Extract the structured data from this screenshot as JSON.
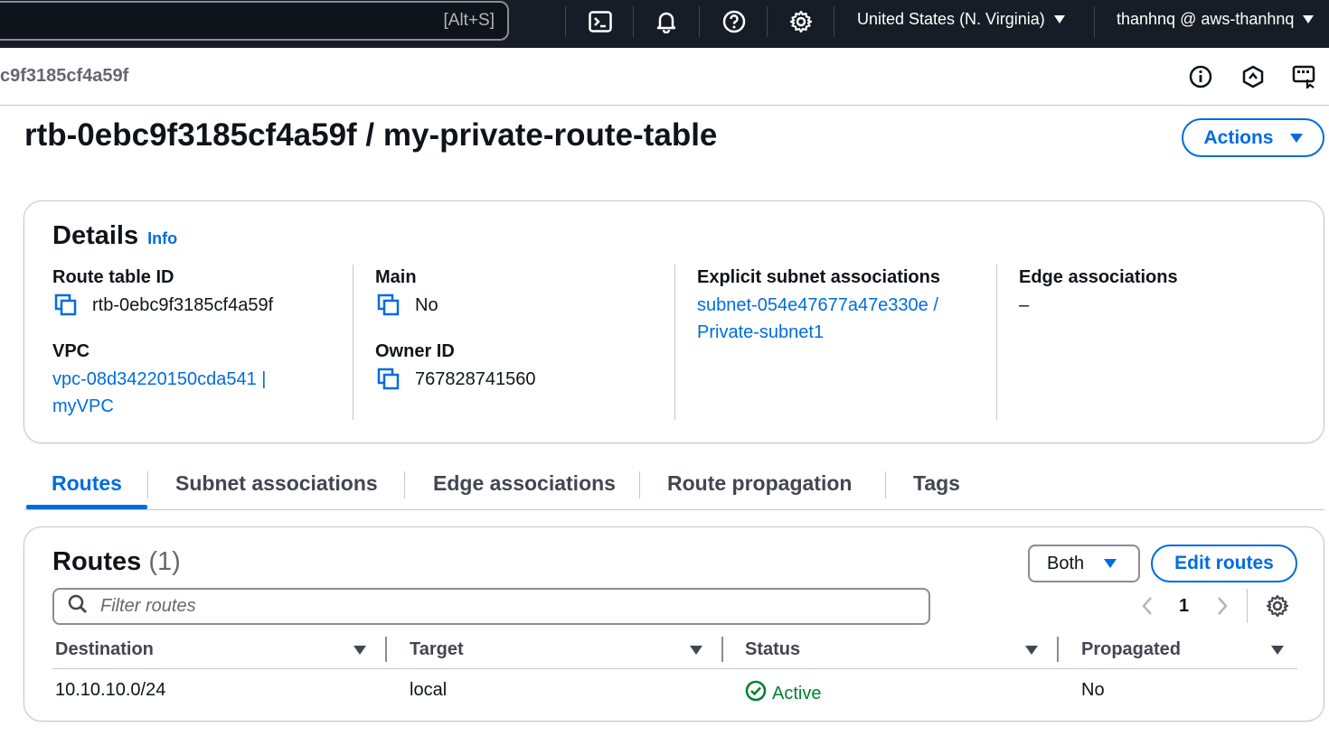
{
  "topnav": {
    "search_shortcut": "[Alt+S]",
    "icons": [
      "cloudshell-icon",
      "bell-icon",
      "help-icon",
      "settings-icon"
    ],
    "region": "United States (N. Virginia)",
    "account": "thanhnq @ aws-thanhnq"
  },
  "breadcrumb": {
    "current": "c9f3185cf4a59f"
  },
  "toolbar_icons": [
    "info-icon",
    "notifications-hex-icon",
    "feedback-icon"
  ],
  "header": {
    "title": "rtb-0ebc9f3185cf4a59f / my-private-route-table",
    "actions_label": "Actions"
  },
  "details": {
    "title": "Details",
    "info_label": "Info",
    "route_table_id_label": "Route table ID",
    "route_table_id": "rtb-0ebc9f3185cf4a59f",
    "vpc_label": "VPC",
    "vpc_line1": "vpc-08d34220150cda541 |",
    "vpc_line2": "myVPC",
    "main_label": "Main",
    "main_value": "No",
    "owner_label": "Owner ID",
    "owner_value": "767828741560",
    "explicit_label": "Explicit subnet associations",
    "explicit_line1": "subnet-054e47677a47e330e /",
    "explicit_line2": "Private-subnet1",
    "edge_label": "Edge associations",
    "edge_value": "–"
  },
  "tabs": [
    "Routes",
    "Subnet associations",
    "Edge associations",
    "Route propagation",
    "Tags"
  ],
  "active_tab": "Routes",
  "routes": {
    "title": "Routes",
    "count": "(1)",
    "filter_select": "Both",
    "edit_label": "Edit routes",
    "filter_placeholder": "Filter routes",
    "page": "1",
    "columns": [
      "Destination",
      "Target",
      "Status",
      "Propagated"
    ],
    "rows": [
      {
        "destination": "10.10.10.0/24",
        "target": "local",
        "status": "Active",
        "propagated": "No"
      }
    ]
  },
  "colors": {
    "nav_bg": "#161d26",
    "link": "#006ce0",
    "success": "#00802f",
    "border": "#c6c6cd"
  }
}
